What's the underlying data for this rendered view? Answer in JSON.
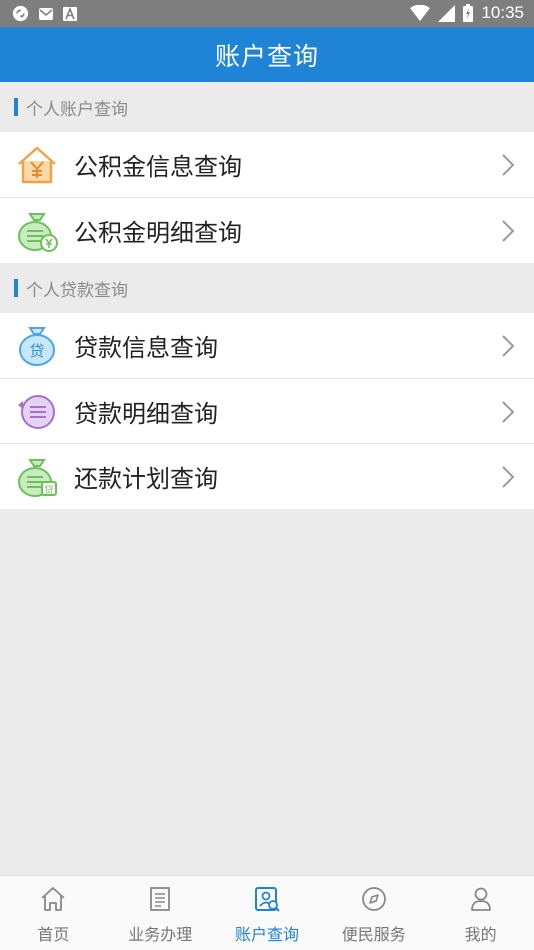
{
  "status_bar": {
    "time": "10:35"
  },
  "header": {
    "title": "账户查询"
  },
  "sections": [
    {
      "title": "个人账户查询",
      "items": [
        {
          "label": "公积金信息查询",
          "icon": "house-yuan-icon"
        },
        {
          "label": "公积金明细查询",
          "icon": "money-bag-yuan-icon"
        }
      ]
    },
    {
      "title": "个人贷款查询",
      "items": [
        {
          "label": "贷款信息查询",
          "icon": "loan-bag-icon"
        },
        {
          "label": "贷款明细查询",
          "icon": "loan-detail-icon"
        },
        {
          "label": "还款计划查询",
          "icon": "repayment-plan-icon"
        }
      ]
    }
  ],
  "tabbar": {
    "tabs": [
      {
        "label": "首页",
        "icon": "home-icon"
      },
      {
        "label": "业务办理",
        "icon": "document-icon"
      },
      {
        "label": "账户查询",
        "icon": "account-search-icon",
        "active": true
      },
      {
        "label": "便民服务",
        "icon": "compass-icon"
      },
      {
        "label": "我的",
        "icon": "user-icon"
      }
    ]
  },
  "colors": {
    "brand": "#1f83d6",
    "status_bar": "#7e7e7e",
    "background": "#ebebeb"
  }
}
